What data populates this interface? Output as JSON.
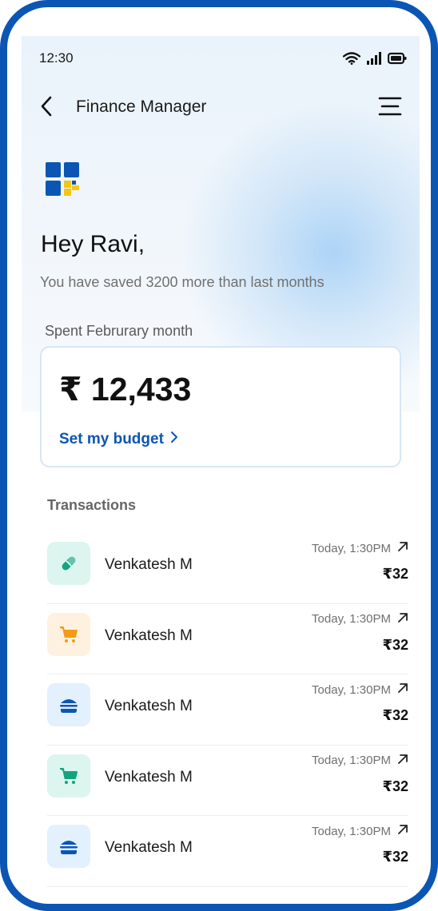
{
  "status_bar": {
    "time": "12:30",
    "icons": [
      "wifi-icon",
      "signal-icon",
      "battery-icon"
    ]
  },
  "header": {
    "title": "Finance Manager",
    "back_icon": "chevron-left-icon",
    "menu_icon": "hamburger-menu-icon"
  },
  "greeting": {
    "title": "Hey Ravi,",
    "subtitle": "You have saved 3200 more than last months"
  },
  "spending": {
    "label": "Spent Februrary month",
    "amount": "₹ 12,433",
    "budget_link": "Set my budget"
  },
  "transactions": {
    "heading": "Transactions",
    "items": [
      {
        "name": "Venkatesh M",
        "time": "Today, 1:30PM",
        "amount": "₹32",
        "icon": "pill-icon",
        "icon_bg": "#dcf5ef",
        "icon_color": "#14a37f"
      },
      {
        "name": "Venkatesh M",
        "time": "Today, 1:30PM",
        "amount": "₹32",
        "icon": "cart-icon",
        "icon_bg": "#fff1df",
        "icon_color": "#f59a14"
      },
      {
        "name": "Venkatesh M",
        "time": "Today, 1:30PM",
        "amount": "₹32",
        "icon": "burger-icon",
        "icon_bg": "#e3f0fd",
        "icon_color": "#0b56b4"
      },
      {
        "name": "Venkatesh M",
        "time": "Today, 1:30PM",
        "amount": "₹32",
        "icon": "cart-icon",
        "icon_bg": "#dcf5ef",
        "icon_color": "#14a37f"
      },
      {
        "name": "Venkatesh M",
        "time": "Today, 1:30PM",
        "amount": "₹32",
        "icon": "burger-icon",
        "icon_bg": "#e3f0fd",
        "icon_color": "#0b56b4"
      }
    ]
  },
  "colors": {
    "frame": "#0b56b4",
    "accent": "#0b56b4",
    "logo_blue": "#0b56b4",
    "logo_yellow": "#f5c518"
  }
}
